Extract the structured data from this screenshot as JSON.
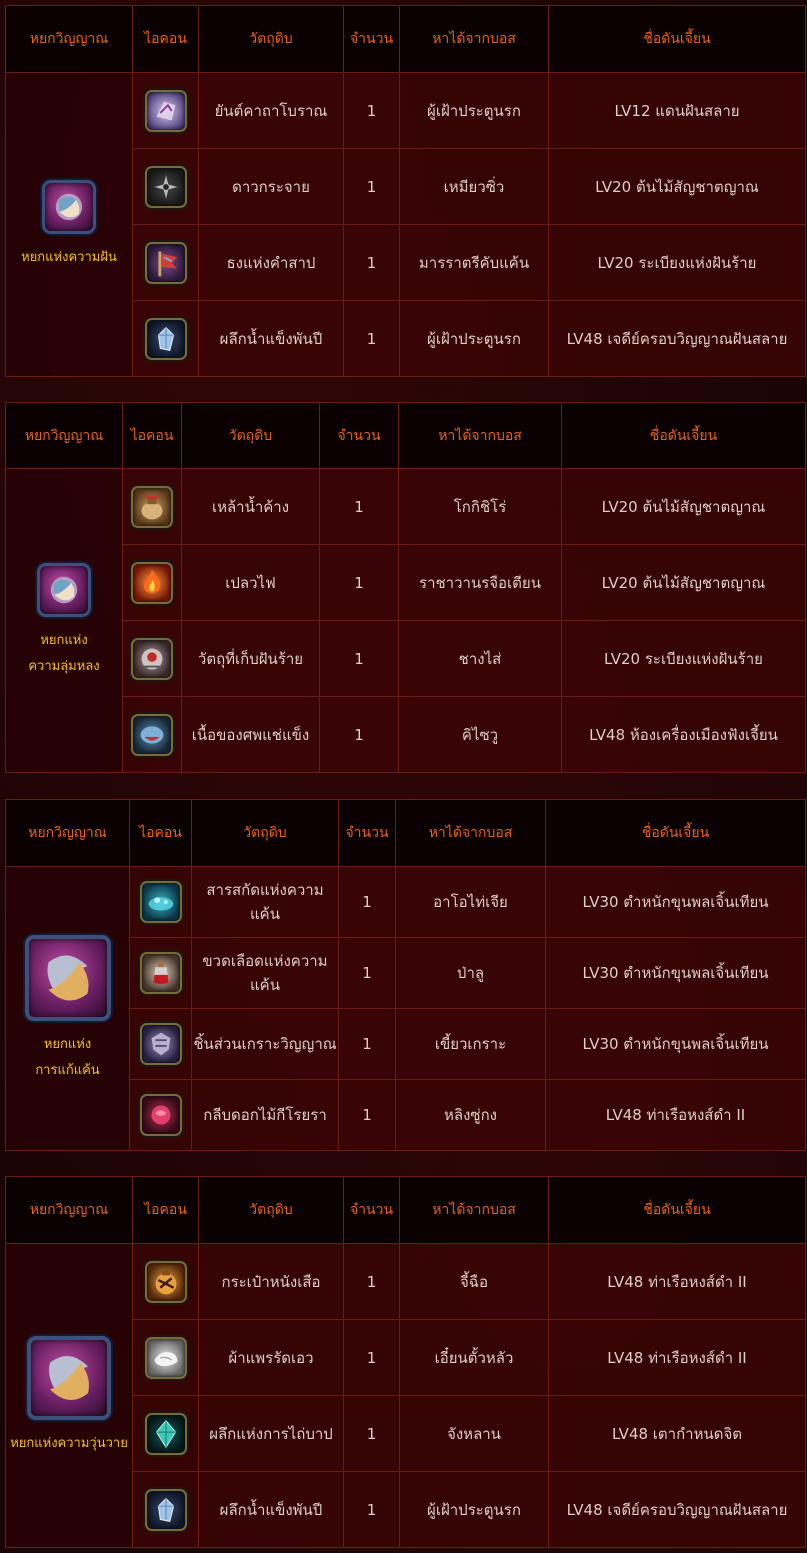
{
  "headers": [
    "หยกวิญญาณ",
    "ไอคอน",
    "วัตถุดิบ",
    "จำนวน",
    "หาได้จากบอส",
    "ชื่อดันเจี้ยน"
  ],
  "tables": [
    {
      "jade": {
        "name": "หยกแห่งความฝัน",
        "icon": "jade-dream-icon"
      },
      "rows": [
        {
          "icon": "ancient-talisman-icon",
          "material": "ยันต์คาถาโบราณ",
          "qty": "1",
          "boss": "ผู้เฝ้าประตูนรก",
          "dungeon": "LV12 แดนฝันสลาย"
        },
        {
          "icon": "shuriken-icon",
          "material": "ดาวกระจาย",
          "qty": "1",
          "boss": "เหมียวซิ่ว",
          "dungeon": "LV20 ต้นไม้สัญชาตญาณ"
        },
        {
          "icon": "cursed-flag-icon",
          "material": "ธงแห่งคำสาป",
          "qty": "1",
          "boss": "มารราตรีคับแค้น",
          "dungeon": "LV20 ระเบียงแห่งฝันร้าย"
        },
        {
          "icon": "ice-crystal-icon",
          "material": "ผลึกน้ำแข็งพันปี",
          "qty": "1",
          "boss": "ผู้เฝ้าประตูนรก",
          "dungeon": "LV48 เจดีย์ครอบวิญญาณฝันสลาย"
        }
      ]
    },
    {
      "jade": {
        "name_line1": "หยกแห่ง",
        "name_line2": "ความลุ่มหลง",
        "icon": "jade-obsession-icon"
      },
      "rows": [
        {
          "icon": "wine-jar-icon",
          "material": "เหล้าน้ำค้าง",
          "qty": "1",
          "boss": "โกกิชิโร่",
          "dungeon": "LV20 ต้นไม้สัญชาตญาณ"
        },
        {
          "icon": "flame-icon",
          "material": "เปลวไฟ",
          "qty": "1",
          "boss": "ราชาวานรจือเตียน",
          "dungeon": "LV20 ต้นไม้สัญชาตญาณ"
        },
        {
          "icon": "nightmare-relic-icon",
          "material": "วัตถุที่เก็บฝันร้าย",
          "qty": "1",
          "boss": "ชางไส่",
          "dungeon": "LV20 ระเบียงแห่งฝันร้าย"
        },
        {
          "icon": "frozen-flesh-icon",
          "material": "เนื้อของศพแช่แข็ง",
          "qty": "1",
          "boss": "คิไซวู",
          "dungeon": "LV48 ห้องเครื่องเมืองฟังเจี้ยน"
        }
      ]
    },
    {
      "jade": {
        "name_line1": "หยกแห่ง",
        "name_line2": "การแก้แค้น",
        "icon": "jade-vengeance-icon"
      },
      "rows": [
        {
          "icon": "vengeance-essence-icon",
          "material": "สารสกัดแห่งความแค้น",
          "qty": "1",
          "boss": "อาโอไท่เจีย",
          "dungeon": "LV30 ตำหนักขุนพลเจิ้นเทียน"
        },
        {
          "icon": "blood-vial-icon",
          "material": "ขวดเลือดแห่งความแค้น",
          "qty": "1",
          "boss": "ป่าลู",
          "dungeon": "LV30 ตำหนักขุนพลเจิ้นเทียน"
        },
        {
          "icon": "soul-armor-shard-icon",
          "material": "ชิ้นส่วนเกราะวิญญาณ",
          "qty": "1",
          "boss": "เขี้ยวเกราะ",
          "dungeon": "LV30 ตำหนักขุนพลเจิ้นเทียน"
        },
        {
          "icon": "rose-petal-icon",
          "material": "กลีบดอกไม้กีโรยรา",
          "qty": "1",
          "boss": "หลิงซู่กง",
          "dungeon": "LV48 ท่าเรือหงส์ดำ II"
        }
      ]
    },
    {
      "jade": {
        "name": "หยกแห่งความวุ่นวาย",
        "icon": "jade-chaos-icon"
      },
      "rows": [
        {
          "icon": "tiger-pouch-icon",
          "material": "กระเป๋าหนังเสือ",
          "qty": "1",
          "boss": "จี้ฉือ",
          "dungeon": "LV48 ท่าเรือหงส์ดำ II"
        },
        {
          "icon": "silk-cloth-icon",
          "material": "ผ้าแพรรัดเอว",
          "qty": "1",
          "boss": "เอี๋ยนตั้วหลัว",
          "dungeon": "LV48 ท่าเรือหงส์ดำ II"
        },
        {
          "icon": "sin-crystal-icon",
          "material": "ผลึกแห่งการไถ่บาป",
          "qty": "1",
          "boss": "จังหลาน",
          "dungeon": "LV48 เตากำหนดจิต"
        },
        {
          "icon": "ice-crystal-icon",
          "material": "ผลึกน้ำแข็งพันปี",
          "qty": "1",
          "boss": "ผู้เฝ้าประตูนรก",
          "dungeon": "LV48 เจดีย์ครอบวิญญาณฝันสลาย"
        }
      ]
    }
  ]
}
